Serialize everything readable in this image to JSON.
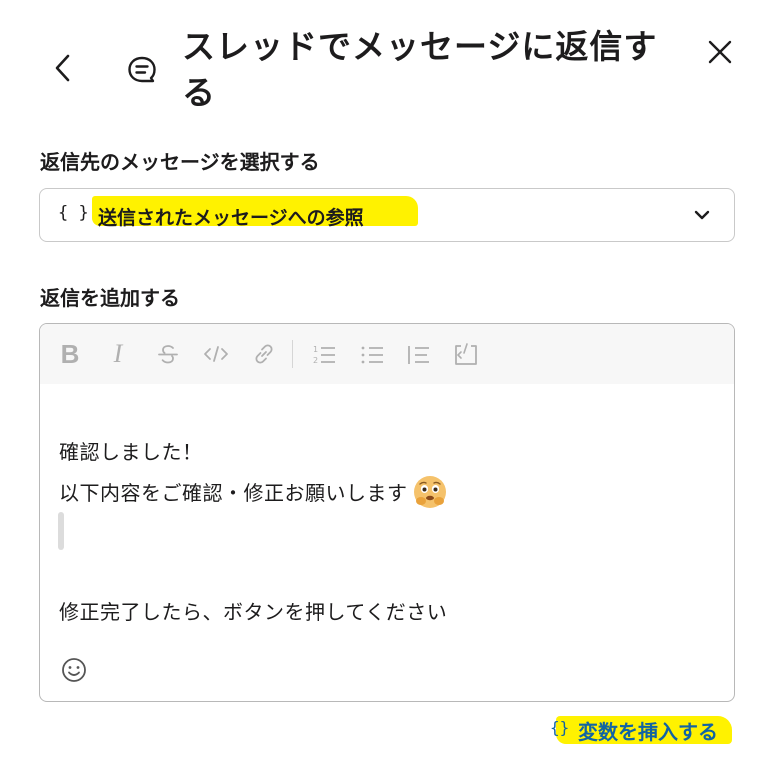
{
  "header": {
    "title": "スレッドでメッセージに返信する",
    "back_icon": "chevron-left-icon",
    "thread_icon": "thread-reply-icon",
    "close_icon": "close-icon"
  },
  "target_section": {
    "label": "返信先のメッセージを選択する",
    "select": {
      "prefix": "{ }",
      "value": "送信されたメッセージへの参照",
      "icon": "chevron-down-icon"
    }
  },
  "reply_section": {
    "label": "返信を追加する",
    "toolbar": [
      "bold-icon",
      "italic-icon",
      "strikethrough-icon",
      "code-icon",
      "link-icon",
      "ordered-list-icon",
      "bullet-list-icon",
      "blockquote-icon",
      "code-block-icon"
    ],
    "toolbar_glyphs": {
      "bold": "B",
      "italic": "I"
    },
    "lines": [
      "確認しました！",
      "以下内容をご確認・修正お願いします",
      "修正完了したら、ボタンを押してください"
    ],
    "emoji_button_icon": "smiley-icon"
  },
  "insert_variable": {
    "prefix": "{}",
    "label": "変数を挿入する"
  },
  "colors": {
    "highlight": "#fff200",
    "link": "#1264a3",
    "text": "#1d1c1d",
    "border": "#c9c9c9",
    "toolbar_bg": "#f7f7f7"
  }
}
